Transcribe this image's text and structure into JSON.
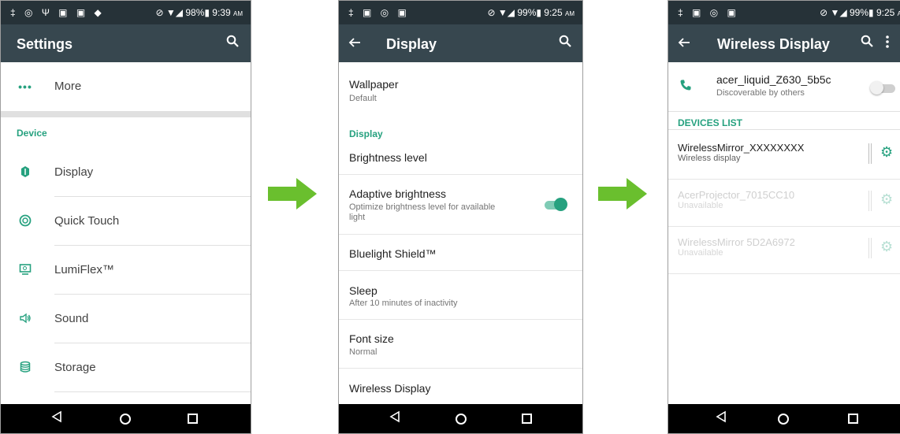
{
  "screen1": {
    "status": {
      "icons_left": "‡ ◎ Ψ ▣ ▣ ◆",
      "right_text": "⊘ ▼◢ 98%▮ 9:39",
      "ampm": "AM"
    },
    "title": "Settings",
    "more_label": "More",
    "section_device": "Device",
    "items": [
      {
        "label": "Display",
        "icon": "display-icon"
      },
      {
        "label": "Quick Touch",
        "icon": "quick-touch-icon"
      },
      {
        "label": "LumiFlex™",
        "icon": "lumiflex-icon"
      },
      {
        "label": "Sound",
        "icon": "sound-icon"
      },
      {
        "label": "Storage",
        "icon": "storage-icon"
      }
    ]
  },
  "screen2": {
    "status": {
      "icons_left": "‡ ▣ ◎ ▣",
      "right_text": "⊘ ▼◢ 99%▮ 9:25",
      "ampm": "AM"
    },
    "title": "Display",
    "wallpaper": {
      "title": "Wallpaper",
      "sub": "Default"
    },
    "section_display": "Display",
    "brightness": "Brightness level",
    "adaptive": {
      "title": "Adaptive brightness",
      "sub1": "Optimize brightness level for available",
      "sub2": "light",
      "enabled": true
    },
    "bluelight": "Bluelight Shield™",
    "sleep": {
      "title": "Sleep",
      "sub": "After 10 minutes of inactivity"
    },
    "font": {
      "title": "Font size",
      "sub": "Normal"
    },
    "wireless": "Wireless Display"
  },
  "screen3": {
    "status": {
      "icons_left": "‡ ▣ ◎ ▣",
      "right_text": "⊘ ▼◢ 99%▮ 9:25",
      "ampm": "A"
    },
    "title": "Wireless Display",
    "own_device": {
      "name": "acer_liquid_Z630_5b5c",
      "sub": "Discoverable by others",
      "enabled": false
    },
    "section_list": "DEVICES LIST",
    "devices": [
      {
        "name": "WirelessMirror_XXXXXXXX",
        "sub": "Wireless display",
        "available": true
      },
      {
        "name": "AcerProjector_7015CC10",
        "sub": "Unavailable",
        "available": false
      },
      {
        "name": "WirelessMirror 5D2A6972",
        "sub": "Unavailable",
        "available": false
      }
    ]
  },
  "colors": {
    "accent": "#26a17f",
    "appbar": "#37474f",
    "statusbar": "#263238",
    "arrow": "#6abf2e"
  }
}
